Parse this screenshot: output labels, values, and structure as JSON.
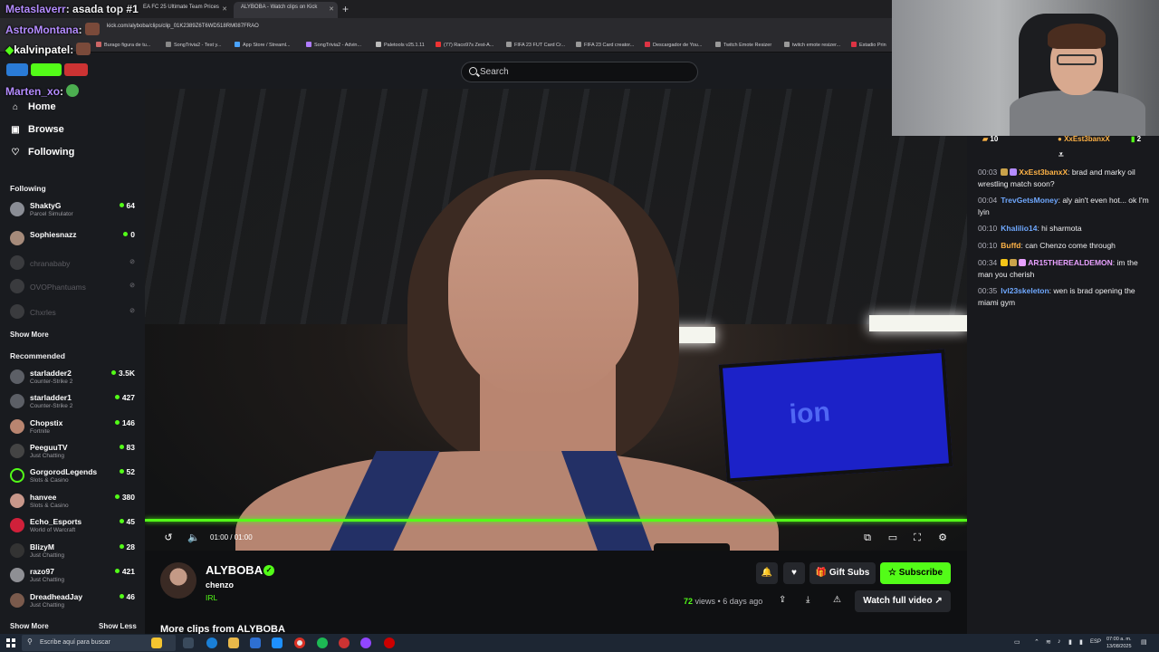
{
  "browser": {
    "tabs": [
      {
        "label": "EA FC 25 Ultimate Team Prices"
      },
      {
        "label": "ALYBOBA - Watch clips on Kick"
      }
    ],
    "url": "kick.com/alyboba/clips/clip_01K2389Z6T6WD518RM087FRAO",
    "bookmarks": [
      "Burago figura de tu...",
      "SongTrivia2 - Test y...",
      "App Store / Streaml...",
      "SongTrivia2 - Advin...",
      "Paletools v25.1.11",
      "(77) Raco97s Zest-A...",
      "FIFA 23 FUT Card Cr...",
      "FIFA 23 Card creator...",
      "Descargador de You...",
      "Twitch Emote Resizer",
      "twitch emote resizer...",
      "Estadio Prin"
    ]
  },
  "overlay_chat": [
    {
      "user": "Metaslaverr",
      "text": ": asada top #1",
      "color": "#b48cff"
    },
    {
      "user": "AstroMontana",
      "text": ":",
      "color": "#b48cff"
    },
    {
      "user": "kalvinpatel",
      "text": ":",
      "color": "#ffffff"
    },
    {
      "user": "Marten_xo",
      "text": ":",
      "color": "#b48cff"
    }
  ],
  "search": {
    "placeholder": "Search"
  },
  "sidebar": {
    "nav": [
      {
        "label": "Home",
        "icon": "home-icon"
      },
      {
        "label": "Browse",
        "icon": "browse-icon"
      },
      {
        "label": "Following",
        "icon": "heart-icon"
      }
    ],
    "following_title": "Following",
    "following": [
      {
        "name": "ShaktyG",
        "category": "Parcel Simulator",
        "viewers": "64",
        "live": true
      },
      {
        "name": "Sophiesnazz",
        "category": "",
        "viewers": "0",
        "live": true
      },
      {
        "name": "chranababy",
        "category": "",
        "viewers": "",
        "live": false
      },
      {
        "name": "OVOPhantuams",
        "category": "",
        "viewers": "",
        "live": false
      },
      {
        "name": "Chxrles",
        "category": "",
        "viewers": "",
        "live": false
      }
    ],
    "show_more": "Show More",
    "recommended_title": "Recommended",
    "recommended": [
      {
        "name": "starladder2",
        "category": "Counter-Strike 2",
        "viewers": "3.5K"
      },
      {
        "name": "starladder1",
        "category": "Counter-Strike 2",
        "viewers": "427"
      },
      {
        "name": "Chopstix",
        "category": "Fortnite",
        "viewers": "146"
      },
      {
        "name": "PeeguuTV",
        "category": "Just Chatting",
        "viewers": "83"
      },
      {
        "name": "GorgorodLegends",
        "category": "Slots & Casino",
        "viewers": "52"
      },
      {
        "name": "hanvee",
        "category": "Slots & Casino",
        "viewers": "380"
      },
      {
        "name": "Echo_Esports",
        "category": "World of Warcraft",
        "viewers": "45"
      },
      {
        "name": "BlizyM",
        "category": "Just Chatting",
        "viewers": "28"
      },
      {
        "name": "razo97",
        "category": "Just Chatting",
        "viewers": "421"
      },
      {
        "name": "DreadheadJay",
        "category": "Just Chatting",
        "viewers": "46"
      }
    ],
    "show_more_2": "Show More",
    "show_less": "Show Less"
  },
  "player": {
    "time": "01:00 / 01:00",
    "progress": 1.0,
    "tv_text": "ion"
  },
  "clip": {
    "streamer": "ALYBOBA",
    "title": "chenzo",
    "category": "IRL",
    "views_count": "72",
    "views_rest": "views • 6 days ago",
    "gift_subs": "Gift Subs",
    "subscribe": "Subscribe",
    "watch_full": "Watch full video",
    "more_clips": "More clips from ALYBOBA"
  },
  "chat": {
    "top_left_count": "10",
    "top_user": "XxEst3banxX",
    "top_count": "2",
    "messages": [
      {
        "ts": "00:03",
        "user": "XxEst3banxX",
        "color": "#ffb347",
        "text": ": brad and marky oil wrestling match soon?"
      },
      {
        "ts": "00:04",
        "user": "TrevGetsMoney",
        "color": "#6fa8ff",
        "text": ": aly ain't even hot... ok I'm lyin"
      },
      {
        "ts": "00:10",
        "user": "Khalilio14",
        "color": "#6fa8ff",
        "text": ": hi sharmota"
      },
      {
        "ts": "00:10",
        "user": "Buffd",
        "color": "#ffb347",
        "text": ": can Chenzo come through"
      },
      {
        "ts": "00:34",
        "user": "AR15THEREALDEMON",
        "color": "#e8a0ff",
        "text": ": im the man you cherish"
      },
      {
        "ts": "00:35",
        "user": "lvl23skeleton",
        "color": "#6fa8ff",
        "text": ": wen is brad opening the miami gym"
      }
    ]
  },
  "taskbar": {
    "search_text": "Escribe aquí para buscar",
    "lang": "ESP",
    "time": "07:00 a. m.",
    "date": "13/08/2025"
  }
}
